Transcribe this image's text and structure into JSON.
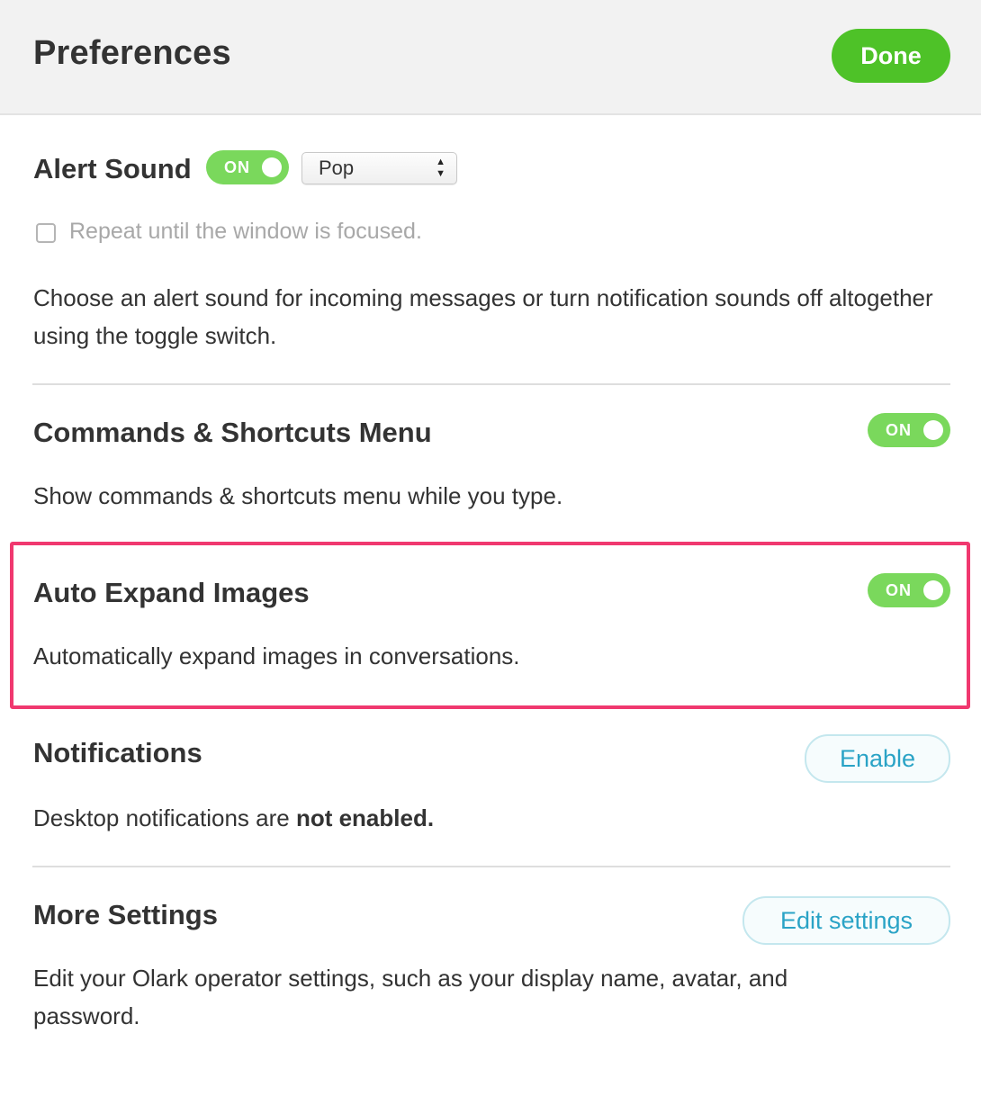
{
  "header": {
    "title": "Preferences",
    "done_label": "Done"
  },
  "alert_sound": {
    "title": "Alert Sound",
    "toggle_label": "ON",
    "toggle_on": true,
    "sound_selected": "Pop",
    "repeat_label": "Repeat until the window is focused.",
    "repeat_checked": false,
    "description": "Choose an alert sound for incoming messages or turn notification sounds off altogether using the toggle switch."
  },
  "commands": {
    "title": "Commands & Shortcuts Menu",
    "toggle_label": "ON",
    "toggle_on": true,
    "description": "Show commands & shortcuts menu while you type."
  },
  "auto_expand": {
    "title": "Auto Expand Images",
    "toggle_label": "ON",
    "toggle_on": true,
    "description": "Automatically expand images in conversations."
  },
  "notifications": {
    "title": "Notifications",
    "button_label": "Enable",
    "description_prefix": "Desktop notifications are ",
    "description_status": "not enabled."
  },
  "more_settings": {
    "title": "More Settings",
    "button_label": "Edit settings",
    "description": "Edit your Olark operator settings, such as your display name, avatar, and password."
  },
  "colors": {
    "accent_green": "#4ec228",
    "toggle_green": "#7ad85c",
    "link_blue": "#2aa3c6",
    "highlight_pink": "#f0386f"
  },
  "icons": {
    "select_arrows": "up-down-arrows-icon",
    "toggle_knob": "toggle-knob-icon"
  }
}
